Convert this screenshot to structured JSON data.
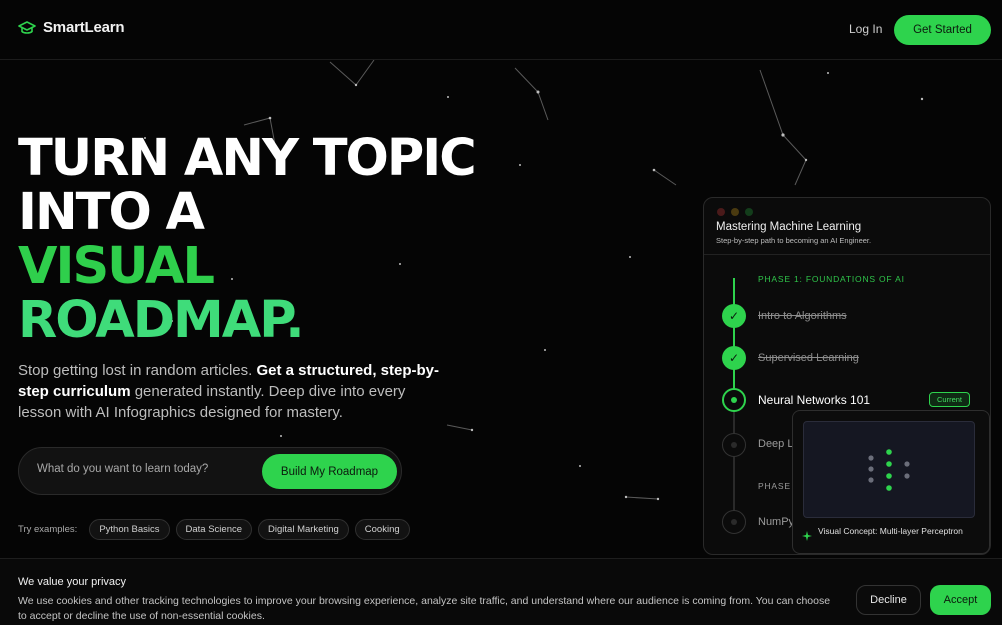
{
  "header": {
    "brand": "SmartLearn",
    "login_label": "Log In",
    "cta_label": "Get Started"
  },
  "hero": {
    "title_line1": "TURN ANY TOPIC",
    "title_line2": "INTO A",
    "title_line3": "VISUAL",
    "title_line4": "ROADMAP.",
    "subtitle_part1": "Stop getting lost in random articles. ",
    "subtitle_bold": "Get a structured, step-by-step curriculum",
    "subtitle_part2": " generated instantly. Deep dive into every lesson with AI Infographics designed for mastery."
  },
  "search": {
    "placeholder": "What do you want to learn today?",
    "button_label": "Build My Roadmap"
  },
  "examples": {
    "label": "Try examples:",
    "chips": [
      "Python Basics",
      "Data Science",
      "Digital Marketing",
      "Cooking"
    ]
  },
  "roadmap": {
    "title": "Mastering Machine Learning",
    "subtitle": "Step-by-step path to becoming an AI Engineer.",
    "phase1": "PHASE 1: FOUNDATIONS OF AI",
    "phase2_partial": "PHASE",
    "lessons": [
      {
        "label": "Intro to Algorithms",
        "state": "done"
      },
      {
        "label": "Supervised Learning",
        "state": "done"
      },
      {
        "label": "Neural Networks 101",
        "state": "current"
      },
      {
        "label": "Deep L",
        "state": "todo"
      },
      {
        "label": "NumPy",
        "state": "todo"
      }
    ],
    "current_badge": "Current",
    "tooltip": "Visual Concept: Multi-layer Perceptron"
  },
  "cookie": {
    "title": "We value your privacy",
    "text": "We use cookies and other tracking technologies to improve your browsing experience, analyze site traffic, and understand where our audience is coming from. You can choose to accept or decline the use of non-essential cookies.",
    "decline_label": "Decline",
    "accept_label": "Accept"
  },
  "colors": {
    "accent": "#2ED34D",
    "background": "#050505"
  }
}
